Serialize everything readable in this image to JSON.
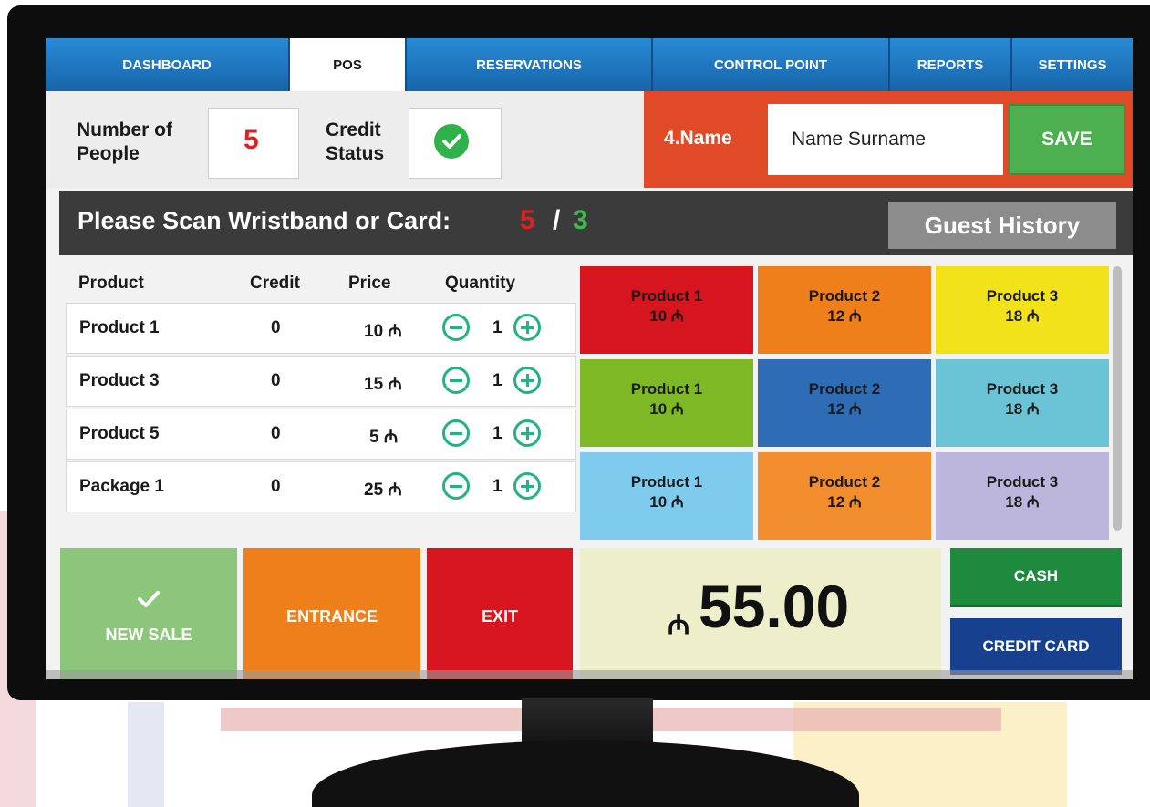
{
  "tabs": [
    {
      "label": "DASHBOARD"
    },
    {
      "label": "POS"
    },
    {
      "label": "RESERVATIONS"
    },
    {
      "label": "CONTROL POINT"
    },
    {
      "label": "REPORTS"
    },
    {
      "label": "SETTINGS"
    }
  ],
  "active_tab": "POS",
  "info": {
    "people_label_1": "Number of",
    "people_label_2": "People",
    "people_value": "5",
    "credit_label_1": "Credit",
    "credit_label_2": "Status",
    "credit_icon": "check-icon"
  },
  "name": {
    "label": "4.Name",
    "value": "Name Surname",
    "save_label": "SAVE"
  },
  "scan": {
    "prompt": "Please Scan Wristband or Card:",
    "scanned": "5",
    "separator": "/",
    "total": "3",
    "guest_history_label": "Guest History"
  },
  "table": {
    "headers": [
      "Product",
      "Credit",
      "Price",
      "Quantity"
    ],
    "rows": [
      {
        "product": "Product 1",
        "credit": "0",
        "price": "10 ₼",
        "qty": "1"
      },
      {
        "product": "Product 3",
        "credit": "0",
        "price": "15 ₼",
        "qty": "1"
      },
      {
        "product": "Product 5",
        "credit": "0",
        "price": "5 ₼",
        "qty": "1"
      },
      {
        "product": "Package 1",
        "credit": "0",
        "price": "25 ₼",
        "qty": "1"
      }
    ]
  },
  "tiles": [
    {
      "name": "Product 1",
      "price": "10 ₼",
      "color": "#d7151e"
    },
    {
      "name": "Product 2",
      "price": "12 ₼",
      "color": "#ef7f1a"
    },
    {
      "name": "Product 3",
      "price": "18 ₼",
      "color": "#f2e21a"
    },
    {
      "name": "Product 1",
      "price": "10 ₼",
      "color": "#7fb825"
    },
    {
      "name": "Product 2",
      "price": "12 ₼",
      "color": "#2e6db5"
    },
    {
      "name": "Product 3",
      "price": "18 ₼",
      "color": "#6bc3d6"
    },
    {
      "name": "Product 1",
      "price": "10 ₼",
      "color": "#7ecbee"
    },
    {
      "name": "Product 2",
      "price": "12 ₼",
      "color": "#f18d2d"
    },
    {
      "name": "Product 3",
      "price": "18 ₼",
      "color": "#bcb6dc"
    }
  ],
  "actions": {
    "new_sale_label": "NEW SALE",
    "entrance_label": "ENTRANCE",
    "exit_label": "EXIT"
  },
  "total": {
    "currency": "₼",
    "amount": "55.00"
  },
  "payment": {
    "cash_label": "CASH",
    "credit_card_label": "CREDIT CARD"
  },
  "colors": {
    "tab_blue": "#1a6fb8",
    "name_panel": "#e04a26",
    "save_green": "#4caf50",
    "scan_bar": "#3b3b3b",
    "new_sale": "#8cc67a",
    "entrance": "#ef7f1a",
    "exit": "#d7151e",
    "total_panel": "#ecefc9",
    "cash": "#1d8a3e",
    "credit_card": "#17408f"
  }
}
